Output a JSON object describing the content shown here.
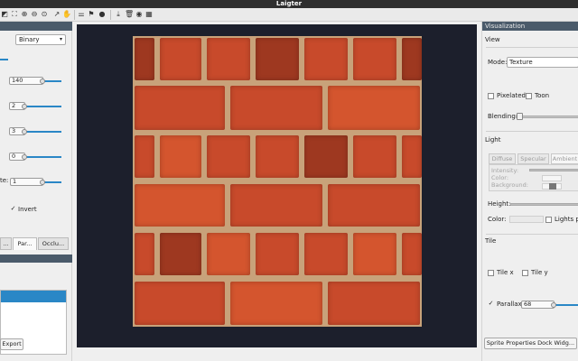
{
  "window": {
    "title": "Laigter"
  },
  "toolbar": {
    "icons": [
      "image-icon",
      "fit-icon",
      "zoom-in-icon",
      "zoom-out-icon",
      "zoom-reset-icon",
      "export-icon",
      "hand-icon",
      "presets-icon",
      "language-icon",
      "info-icon",
      "download-icon",
      "trash-icon",
      "record-icon",
      "grid-icon"
    ]
  },
  "left_panel": {
    "mode_select": "Binary",
    "spin_values": [
      "140",
      "2",
      "3",
      "0",
      "1"
    ],
    "partial_label": "te:",
    "invert_label": "Invert",
    "tabs": [
      "...",
      "Par...",
      "Occlu..."
    ],
    "export_button": "Export"
  },
  "right_panel": {
    "header": "Visualization",
    "view_title": "View",
    "mode_label": "Mode:",
    "mode_value": "Texture",
    "pixelated_label": "Pixelated",
    "toon_label": "Toon",
    "blending_label": "Blending:",
    "light_title": "Light",
    "light_tabs": [
      "Diffuse",
      "Specular",
      "Ambient"
    ],
    "intensity_label": "Intensity:",
    "color_label_gray": "Color:",
    "background_label": "Background:",
    "height_label": "Height:",
    "color_label": "Color:",
    "lights_label": "Lights pe",
    "tile_title": "Tile",
    "tile_x_label": "Tile x",
    "tile_y_label": "Tile y",
    "parallax_label": "Parallax",
    "parallax_value": "68",
    "dock_button": "Sprite Properties Dock Widg..."
  },
  "colors": {
    "accent": "#2a87c6",
    "viewport_bg": "#1c1f2c",
    "brick": "#c84a2b",
    "mortar": "#c8a27a"
  }
}
